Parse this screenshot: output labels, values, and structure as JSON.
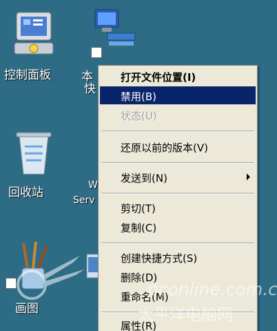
{
  "desktop": {
    "icons": {
      "control_panel": "控制面板",
      "computer_partial": "本",
      "computer_partial2": "快",
      "recycle_bin": "回收站",
      "windows_partial": "W",
      "windows_partial2": "Serv",
      "paint_partial": "画图"
    }
  },
  "context_menu": {
    "open_location": "打开文件位置(I)",
    "disable": "禁用(B)",
    "status": "状态(U)",
    "restore": "还原以前的版本(V)",
    "send_to": "发送到(N)",
    "cut": "剪切(T)",
    "copy": "复制(C)",
    "create_shortcut": "创建快捷方式(S)",
    "delete": "删除(D)",
    "rename": "重命名(M)",
    "properties": "属性(R)"
  },
  "watermark": {
    "site": "pconline.com.cn",
    "brand": "太平洋电脑网"
  },
  "colors": {
    "desktop_bg": "#2e6c86",
    "menu_bg": "#ece9d8",
    "highlight": "#0a246a"
  }
}
